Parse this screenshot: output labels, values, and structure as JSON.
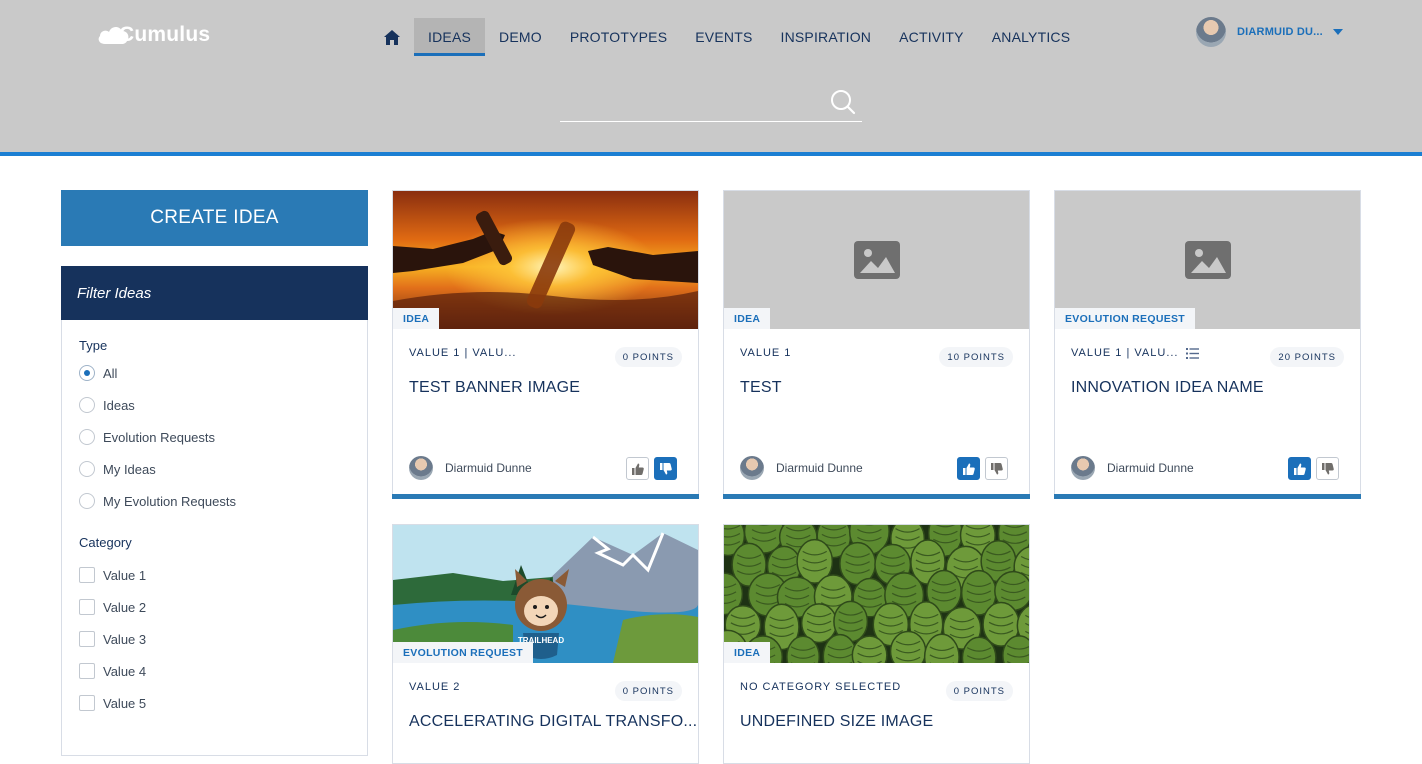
{
  "app": {
    "logo_text": "Cumulus"
  },
  "nav": {
    "items": [
      {
        "label": "IDEAS",
        "active": true
      },
      {
        "label": "DEMO"
      },
      {
        "label": "PROTOTYPES"
      },
      {
        "label": "EVENTS"
      },
      {
        "label": "INSPIRATION"
      },
      {
        "label": "ACTIVITY"
      },
      {
        "label": "ANALYTICS"
      }
    ]
  },
  "user": {
    "name": "DIARMUID DU..."
  },
  "search": {
    "placeholder": ""
  },
  "sidebar": {
    "create_label": "CREATE IDEA",
    "filter_title": "Filter Ideas",
    "type_title": "Type",
    "types": [
      "All",
      "Ideas",
      "Evolution Requests",
      "My Ideas",
      "My Evolution Requests"
    ],
    "selected_type": "All",
    "category_title": "Category",
    "categories": [
      "Value 1",
      "Value 2",
      "Value 3",
      "Value 4",
      "Value 5"
    ]
  },
  "cards": [
    {
      "tag": "IDEA",
      "category": "VALUE 1 | VALU...",
      "points": "0 POINTS",
      "title": "TEST BANNER IMAGE",
      "author": "Diarmuid Dunne",
      "upvoted": false,
      "downvoted": true,
      "image": "sunset-bottles"
    },
    {
      "tag": "IDEA",
      "category": "VALUE 1",
      "points": "10 POINTS",
      "title": "TEST",
      "author": "Diarmuid Dunne",
      "upvoted": true,
      "downvoted": false,
      "image": "placeholder"
    },
    {
      "tag": "EVOLUTION REQUEST",
      "category": "VALUE 1 | VALU...",
      "points": "20 POINTS",
      "title": "INNOVATION IDEA NAME",
      "author": "Diarmuid Dunne",
      "upvoted": true,
      "downvoted": false,
      "image": "placeholder"
    },
    {
      "tag": "EVOLUTION REQUEST",
      "category": "VALUE 2",
      "points": "0 POINTS",
      "title": "ACCELERATING DIGITAL TRANSFO...",
      "image": "trailhead-landscape"
    },
    {
      "tag": "IDEA",
      "category": "NO CATEGORY SELECTED",
      "points": "0 POINTS",
      "title": "UNDEFINED SIZE IMAGE",
      "image": "hops"
    }
  ],
  "colors": {
    "header_bg": "#c9c9c9",
    "accent": "#1b6fba",
    "navy": "#16325c",
    "create_btn": "#2a7ab5"
  }
}
